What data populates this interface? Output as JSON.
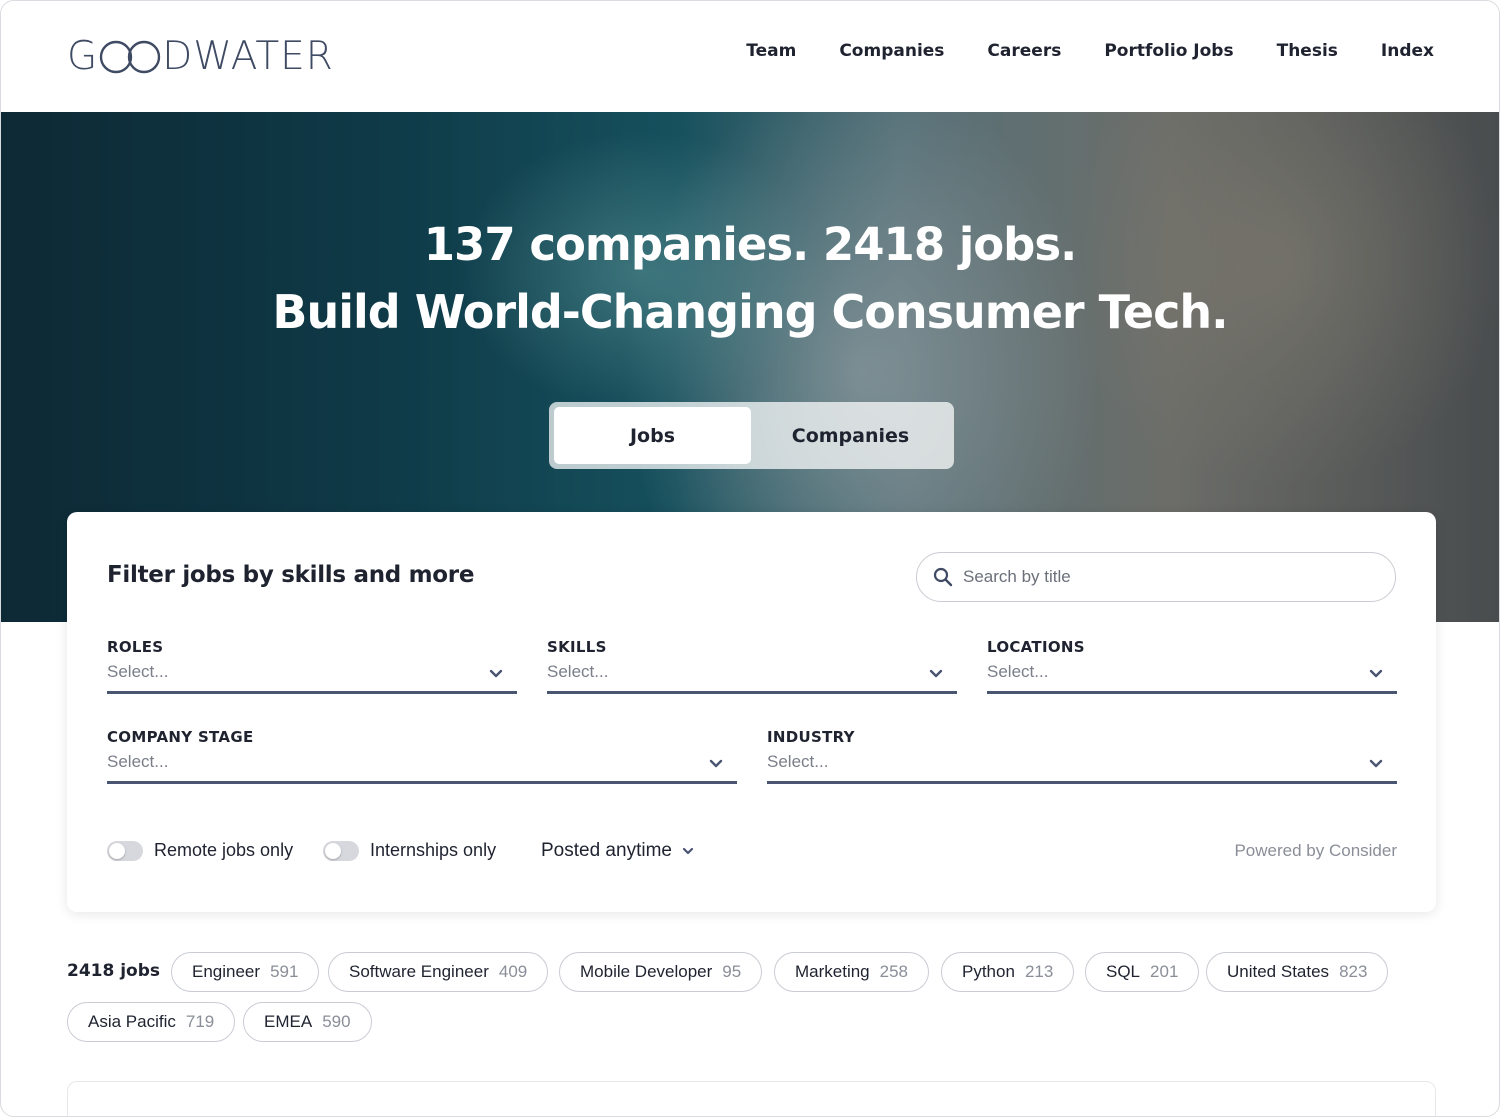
{
  "header": {
    "logo_text": "GOODWATER",
    "nav": [
      "Team",
      "Companies",
      "Careers",
      "Portfolio Jobs",
      "Thesis",
      "Index"
    ]
  },
  "hero": {
    "line1": "137 companies. 2418 jobs.",
    "line2": "Build World-Changing Consumer Tech.",
    "toggle": {
      "active": "Jobs",
      "inactive": "Companies"
    }
  },
  "filters": {
    "title": "Filter jobs by skills and more",
    "search_placeholder": "Search by title",
    "fields": [
      {
        "label": "ROLES",
        "placeholder": "Select..."
      },
      {
        "label": "SKILLS",
        "placeholder": "Select..."
      },
      {
        "label": "LOCATIONS",
        "placeholder": "Select..."
      },
      {
        "label": "COMPANY STAGE",
        "placeholder": "Select..."
      },
      {
        "label": "INDUSTRY",
        "placeholder": "Select..."
      }
    ],
    "remote_label": "Remote jobs only",
    "internships_label": "Internships only",
    "posted_label": "Posted anytime",
    "powered_by": "Powered by Consider",
    "remote_on": false,
    "internships_on": false
  },
  "results": {
    "count_label": "2418 jobs",
    "chips": [
      {
        "label": "Engineer",
        "count": "591"
      },
      {
        "label": "Software Engineer",
        "count": "409"
      },
      {
        "label": "Mobile Developer",
        "count": "95"
      },
      {
        "label": "Marketing",
        "count": "258"
      },
      {
        "label": "Python",
        "count": "213"
      },
      {
        "label": "SQL",
        "count": "201"
      },
      {
        "label": "United States",
        "count": "823"
      },
      {
        "label": "Asia Pacific",
        "count": "719"
      },
      {
        "label": "EMEA",
        "count": "590"
      }
    ]
  },
  "icons": {
    "search": "search-icon",
    "chevron": "chevron-down-icon"
  },
  "colors": {
    "field_underline": "#4a5572",
    "logo": "#3f4a63"
  }
}
